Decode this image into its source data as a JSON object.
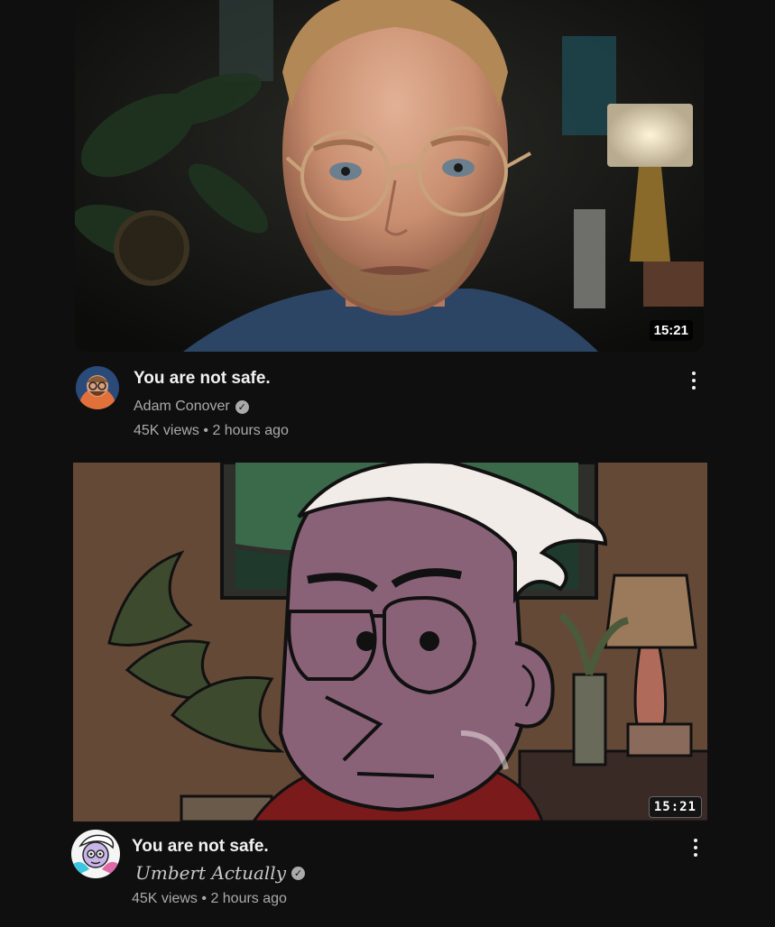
{
  "videos": [
    {
      "title": "You are not safe.",
      "channel": "Adam Conover",
      "verified_icon": "check-circle-icon",
      "views": "45K views",
      "separator": "•",
      "age": "2 hours ago",
      "duration": "15:21",
      "menu_icon": "more-vert-icon"
    },
    {
      "title": "You are not safe.",
      "channel": "Umbert Actually",
      "verified_icon": "check-circle-icon",
      "views": "45K views",
      "separator": "•",
      "age": "2 hours ago",
      "duration": "15:21",
      "menu_icon": "more-vert-icon"
    }
  ],
  "colors": {
    "background": "#0f0f0f",
    "text_primary": "#f1f1f1",
    "text_secondary": "#aaaaaa"
  }
}
